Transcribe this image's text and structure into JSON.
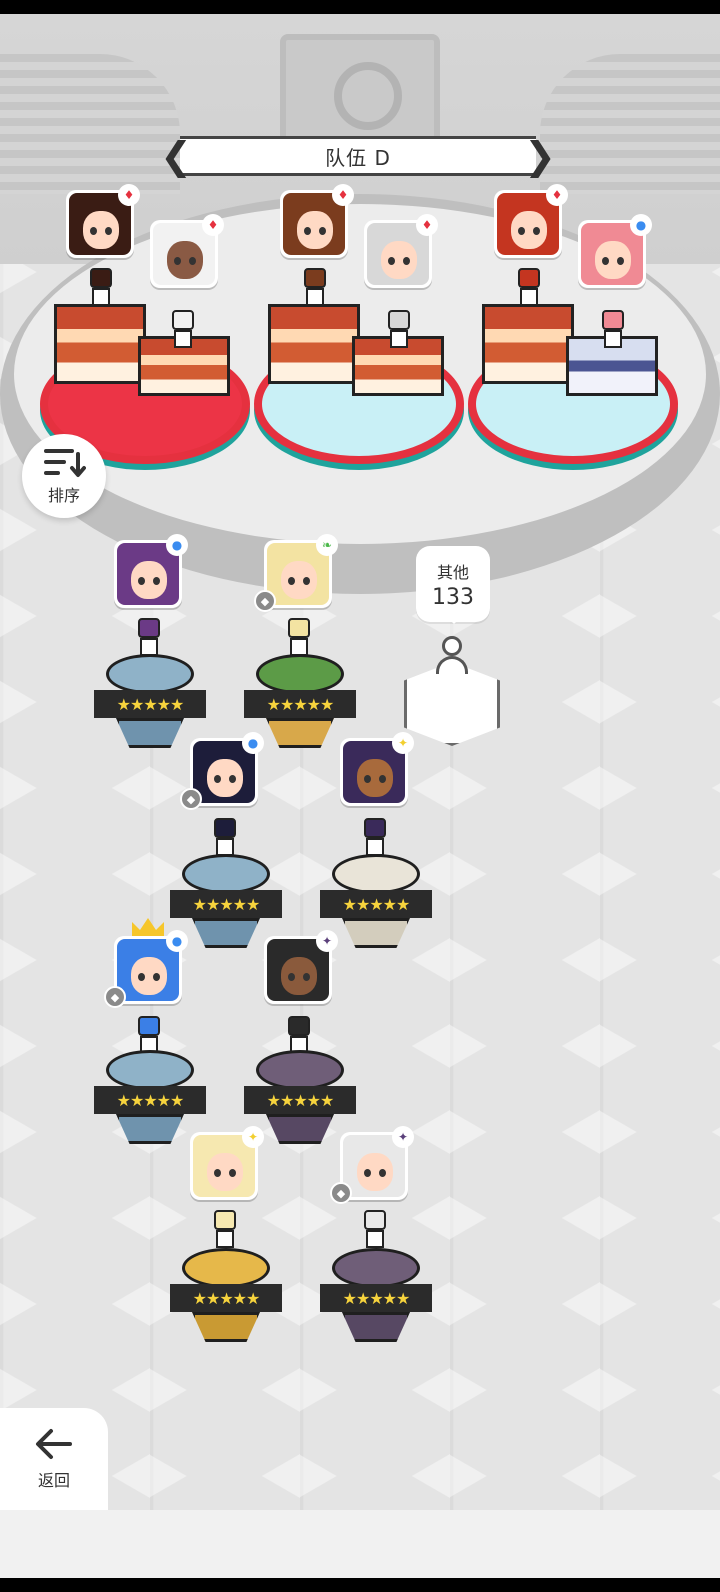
{
  "title": "队伍 D",
  "nav": {
    "prev_icon": "❮",
    "next_icon": "❯"
  },
  "sort_button": {
    "label": "排序",
    "icon": "sort-list-icon"
  },
  "back_button": {
    "label": "返回",
    "icon": "arrow-left-icon"
  },
  "other": {
    "label": "其他",
    "count": "133"
  },
  "star_text": "★★★★★",
  "colors": {
    "team_red": "#ec3446",
    "team_cyan": "#c9f0f6",
    "team_border": "#e5313f",
    "star": "#f6d33d",
    "element_red": "#e5313f",
    "element_blue": "#3a8cf0",
    "element_green": "#4bb84a",
    "element_light": "#f2cf2f",
    "element_dark": "#5a3f7a"
  },
  "team_members": [
    {
      "element": "red",
      "hair": "#3a1c14"
    },
    {
      "element": "red",
      "hair": "#f2f2f2"
    },
    {
      "element": "red",
      "hair": "#7b3c1e"
    },
    {
      "element": "red",
      "hair": "#d8d8d8"
    },
    {
      "element": "red",
      "hair": "#c43520"
    },
    {
      "element": "blue",
      "hair": "#f08a94"
    }
  ],
  "roster": [
    {
      "element": "blue",
      "hair": "#6b3a86",
      "pedestal": "#8fb2c8"
    },
    {
      "element": "green",
      "hair": "#f3e3a2",
      "pedestal": "#5c9b47"
    },
    {
      "element": "blue",
      "hair": "#1d1d3a",
      "pedestal": "#8fb2c8"
    },
    {
      "element": "light",
      "hair": "#3a2a5a",
      "pedestal": "#e9e4d8"
    },
    {
      "element": "blue",
      "hair": "#3b7fe6",
      "pedestal": "#8fb2c8"
    },
    {
      "element": "dark",
      "hair": "#2a2a2a",
      "pedestal": "#6f5e78"
    },
    {
      "element": "light",
      "hair": "#f6e8b0",
      "pedestal": "#e6b84a"
    },
    {
      "element": "dark",
      "hair": "#e8e8e8",
      "pedestal": "#6f5e78"
    }
  ]
}
